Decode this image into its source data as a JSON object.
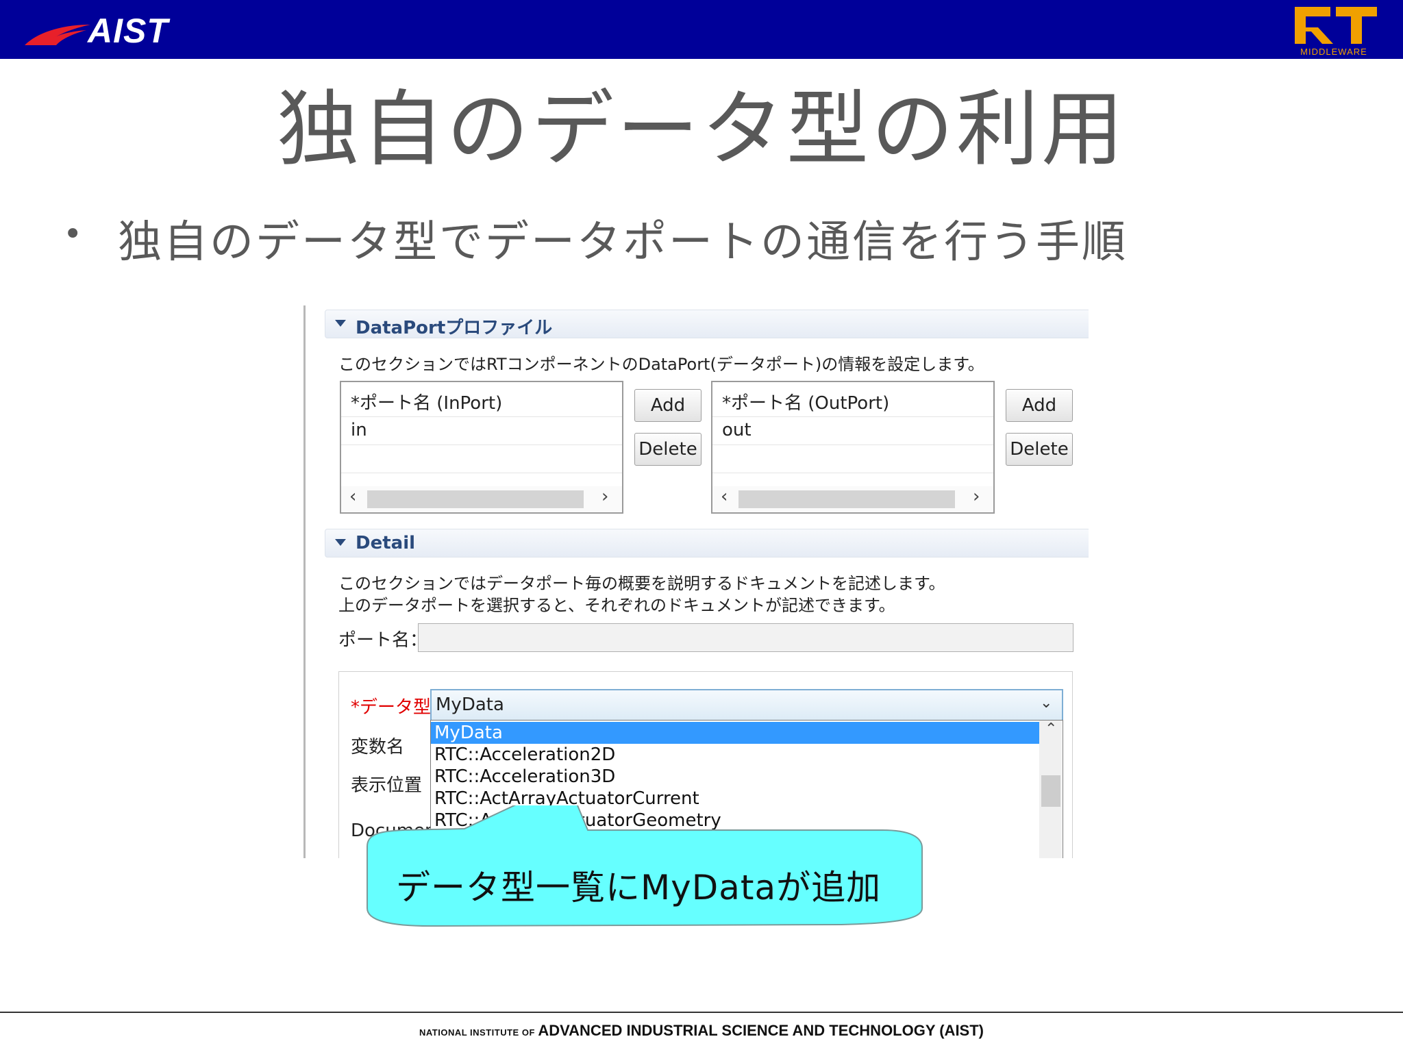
{
  "header": {
    "logo_text": "AIST",
    "rt_logo_sub": "MIDDLEWARE",
    "brand_color": "#000099",
    "rt_color": "#f0a000"
  },
  "slide": {
    "title": "独自のデータ型の利用",
    "bullet": "独自のデータ型でデータポートの通信を行う手順"
  },
  "dataport_section": {
    "title": "DataPortプロファイル",
    "description": "このセクションではRTコンポーネントのDataPort(データポート)の情報を設定します。",
    "inport_table": {
      "header": "*ポート名 (InPort)",
      "rows": [
        "in"
      ]
    },
    "outport_table": {
      "header": "*ポート名 (OutPort)",
      "rows": [
        "out"
      ]
    },
    "add_label": "Add",
    "delete_label": "Delete"
  },
  "detail_section": {
    "title": "Detail",
    "description_line1": "このセクションではデータポート毎の概要を説明するドキュメントを記述します。",
    "description_line2": "上のデータポートを選択すると、それぞれのドキュメントが記述できます。",
    "portname_label": "ポート名：",
    "portname_value": "",
    "datatype_label": "*データ型",
    "datatype_value": "MyData",
    "varname_label": "変数名",
    "position_label": "表示位置",
    "document_label": "Documen",
    "dropdown_options": [
      "MyData",
      "RTC::Acceleration2D",
      "RTC::Acceleration3D",
      "RTC::ActArrayActuatorCurrent",
      "RTC::ActArrayActuatorGeometry"
    ]
  },
  "callout": {
    "text": "データ型一覧にMyDataが追加",
    "fill_color": "#66ffff"
  },
  "footer": {
    "small_text": "NATIONAL INSTITUTE OF",
    "big_text": "ADVANCED INDUSTRIAL SCIENCE AND TECHNOLOGY (AIST)"
  }
}
